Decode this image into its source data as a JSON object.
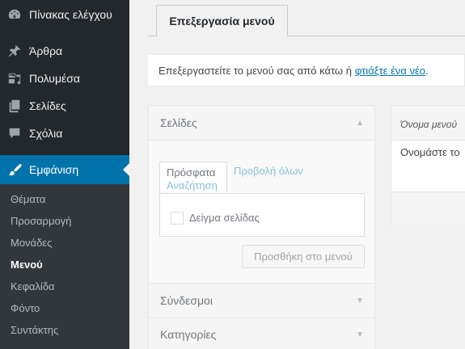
{
  "sidebar": {
    "items": [
      {
        "label": "Πίνακας ελέγχου",
        "icon": "dashboard-icon"
      },
      {
        "label": "Άρθρα",
        "icon": "pushpin-icon"
      },
      {
        "label": "Πολυμέσα",
        "icon": "media-icon"
      },
      {
        "label": "Σελίδες",
        "icon": "pages-icon"
      },
      {
        "label": "Σχόλια",
        "icon": "comments-icon"
      },
      {
        "label": "Εμφάνιση",
        "icon": "appearance-brush-icon"
      }
    ],
    "submenu": [
      {
        "label": "Θέματα"
      },
      {
        "label": "Προσαρμογή"
      },
      {
        "label": "Μονάδες"
      },
      {
        "label": "Μενού"
      },
      {
        "label": "Κεφαλίδα"
      },
      {
        "label": "Φόντο"
      },
      {
        "label": "Συντάκτης"
      }
    ],
    "active_color": "#0073aa"
  },
  "tabs": {
    "active": "Επεξεργασία μενού"
  },
  "notice": {
    "text": "Επεξεργαστείτε το μενού σας από κάτω ή",
    "link": "φτιάξτε ένα νέο",
    "suffix": "."
  },
  "accordion": {
    "pages": {
      "title": "Σελίδες",
      "tab_recent": "Πρόσφατα",
      "tab_all": "Προβολή όλων",
      "tab_search": "Αναζήτηση",
      "item_label": "Δείγμα σελίδας",
      "add_button": "Προσθήκη στο μενού"
    },
    "links": {
      "title": "Σύνδεσμοι"
    },
    "categories": {
      "title": "Κατηγορίες"
    }
  },
  "menu_panel": {
    "name_label": "Όνομα μενού",
    "prompt": "Ονομάστε το"
  }
}
